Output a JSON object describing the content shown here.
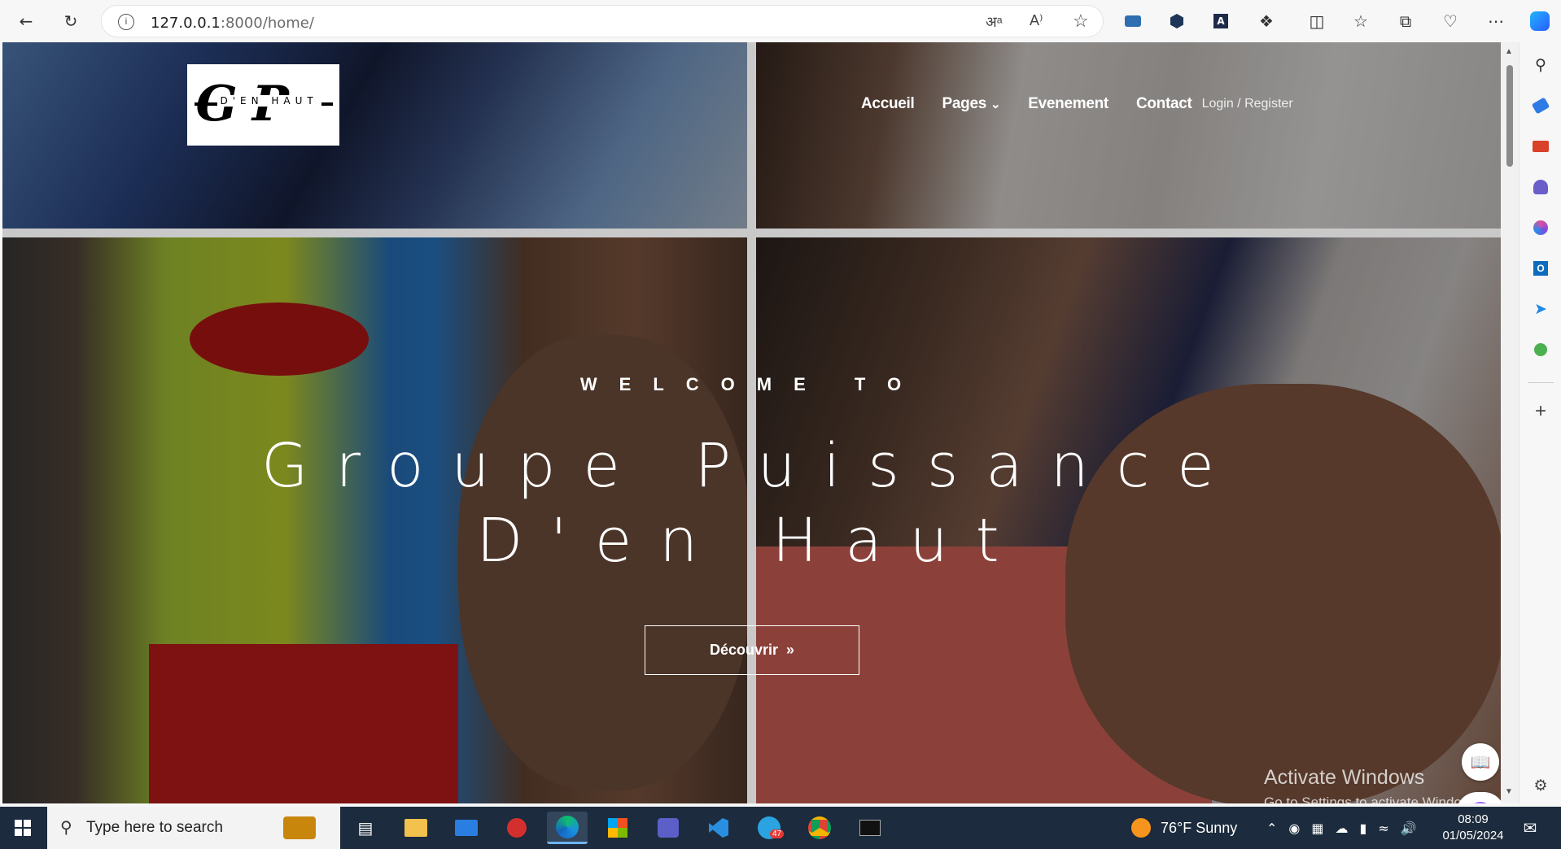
{
  "browser": {
    "url_host": "127.0.0.1",
    "url_rest": ":8000/home/",
    "accent": "#0078d4"
  },
  "site": {
    "logo_big": "GP",
    "logo_small": "D'EN HAUT",
    "nav": {
      "home": "Accueil",
      "pages": "Pages",
      "events": "Evenement",
      "contact": "Contact",
      "login": "Login",
      "register": "Register",
      "separator": "/"
    },
    "hero": {
      "welcome": "WELCOME TO",
      "title_line1": "Groupe Puissance",
      "title_line2": "D'en Haut",
      "button": "Découvrir"
    }
  },
  "windows_notice": {
    "line1": "Activate Windows",
    "line2": "Go to Settings to activate Windows."
  },
  "taskbar": {
    "search_placeholder": "Type here to search",
    "telegram_badge": "47",
    "weather": "76°F  Sunny",
    "time": "08:09",
    "date": "01/05/2024"
  }
}
